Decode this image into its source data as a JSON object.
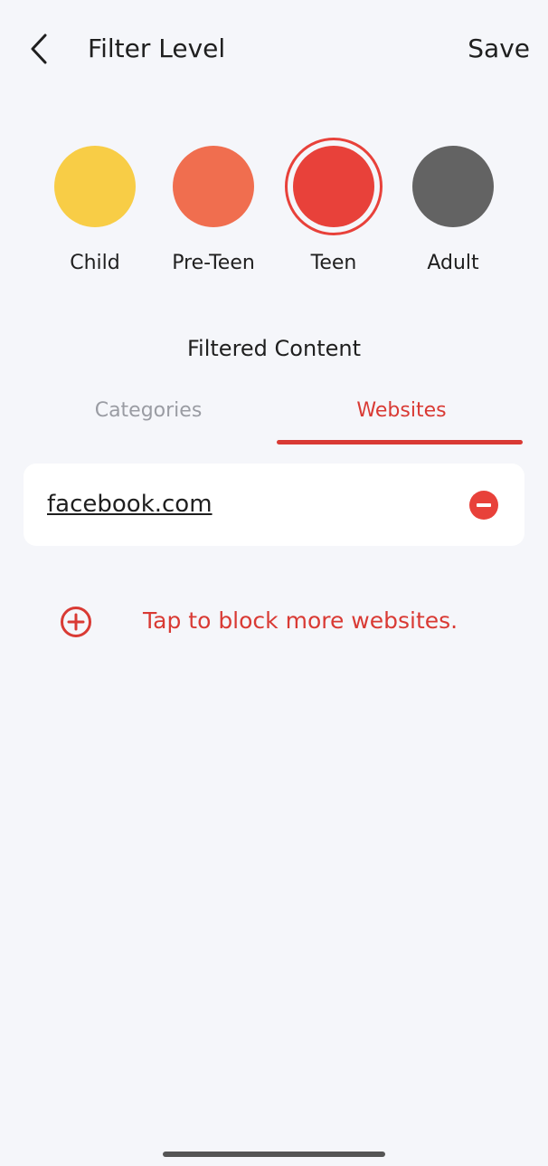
{
  "header": {
    "title": "Filter Level",
    "save_label": "Save"
  },
  "levels": [
    {
      "label": "Child",
      "color": "#f8cd46",
      "selected": false
    },
    {
      "label": "Pre-Teen",
      "color": "#f06e4f",
      "selected": false
    },
    {
      "label": "Teen",
      "color": "#e8413a",
      "selected": true
    },
    {
      "label": "Adult",
      "color": "#636363",
      "selected": false
    }
  ],
  "filtered_content": {
    "title": "Filtered Content",
    "tabs": [
      {
        "label": "Categories",
        "active": false
      },
      {
        "label": "Websites",
        "active": true
      }
    ]
  },
  "websites": [
    {
      "name": "facebook.com"
    }
  ],
  "add_action": {
    "label": "Tap to block more websites."
  },
  "colors": {
    "accent": "#d93a34",
    "background": "#f5f6fa"
  },
  "icons": {
    "back": "chevron-left-icon",
    "remove": "minus-circle-icon",
    "add": "plus-circle-icon"
  }
}
